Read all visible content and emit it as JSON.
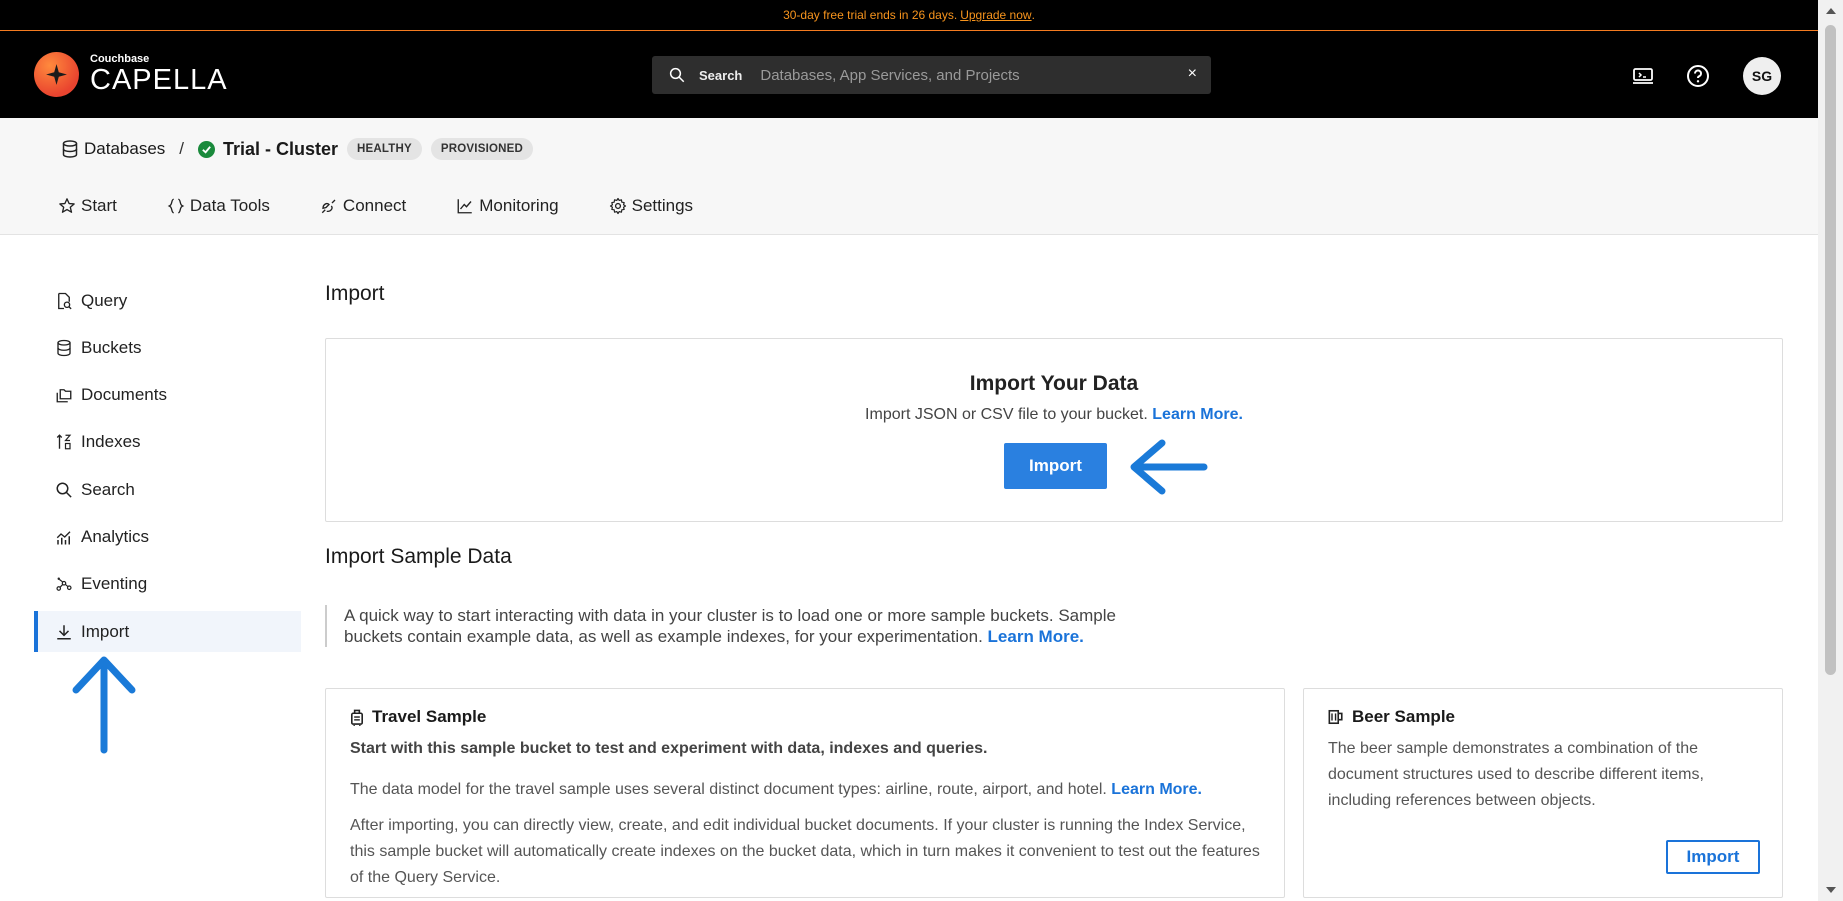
{
  "banner": {
    "text": "30-day free trial ends in 26 days.",
    "link": "Upgrade now",
    "suffix": "."
  },
  "brand": {
    "small": "Couchbase",
    "big": "CAPELLA"
  },
  "search": {
    "label": "Search",
    "placeholder": "Databases, App Services, and Projects",
    "clear": "×"
  },
  "header": {
    "avatar_initials": "SG"
  },
  "breadcrumb": {
    "databases": "Databases",
    "separator": "/",
    "cluster": "Trial - Cluster",
    "badges": [
      "HEALTHY",
      "PROVISIONED"
    ]
  },
  "tabs": [
    {
      "label": "Start",
      "icon": "star-icon"
    },
    {
      "label": "Data Tools",
      "icon": "braces-icon"
    },
    {
      "label": "Connect",
      "icon": "connect-icon"
    },
    {
      "label": "Monitoring",
      "icon": "chart-line-icon"
    },
    {
      "label": "Settings",
      "icon": "gear-icon"
    }
  ],
  "sidebar": {
    "items": [
      {
        "label": "Query",
        "icon": "query-icon"
      },
      {
        "label": "Buckets",
        "icon": "database-icon"
      },
      {
        "label": "Documents",
        "icon": "documents-icon"
      },
      {
        "label": "Indexes",
        "icon": "indexes-icon"
      },
      {
        "label": "Search",
        "icon": "search-icon"
      },
      {
        "label": "Analytics",
        "icon": "analytics-icon"
      },
      {
        "label": "Eventing",
        "icon": "eventing-icon"
      },
      {
        "label": "Import",
        "icon": "download-icon",
        "active": true
      }
    ]
  },
  "main": {
    "title": "Import",
    "import_card": {
      "title": "Import Your Data",
      "desc": "Import JSON or CSV file to your bucket.",
      "link": "Learn More.",
      "button": "Import"
    },
    "sample_title": "Import Sample Data",
    "intro": {
      "text": "A quick way to start interacting with data in your cluster is to load one or more sample buckets. Sample buckets contain example data, as well as example indexes, for your experimentation.",
      "link": "Learn More."
    },
    "travel": {
      "title": "Travel Sample",
      "lead": "Start with this sample bucket to test and experiment with data, indexes and queries.",
      "p2": "The data model for the travel sample uses several distinct document types: airline, route, airport, and hotel.",
      "p2_link": "Learn More.",
      "p3": "After importing, you can directly view, create, and edit individual bucket documents. If your cluster is running the Index Service, this sample bucket will automatically create indexes on the bucket data, which in turn makes it convenient to test out the features of the Query Service."
    },
    "beer": {
      "title": "Beer Sample",
      "desc": "The beer sample demonstrates a combination of the document structures used to describe different items, including references between objects.",
      "button": "Import"
    }
  },
  "colors": {
    "accent": "#1a73d9",
    "primary_button": "#2a80e0",
    "banner_text": "#f7941d",
    "healthy": "#1a8a3c"
  }
}
